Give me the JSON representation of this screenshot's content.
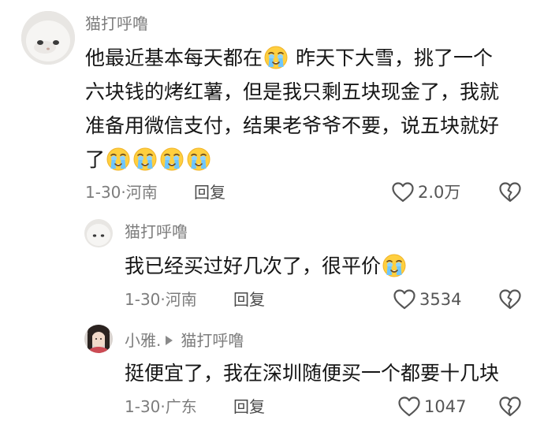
{
  "comments": [
    {
      "username": "猫打呼噜",
      "lines": [
        [
          "他最近基本每天都在",
          " 昨天下大雪，挑了一个"
        ],
        [
          "六块钱的烤红薯，但是我只剩五块现金了，我就"
        ],
        [
          "准备用微信支付，结果老爷爷不要，说五块就好"
        ],
        [
          "了"
        ]
      ],
      "date": "1-30",
      "location": "河南",
      "reply_label": "回复",
      "likes": "2.0万"
    },
    {
      "username": "猫打呼噜",
      "text": "我已经买过好几次了，很平价",
      "date": "1-30",
      "location": "河南",
      "reply_label": "回复",
      "likes": "3534"
    },
    {
      "username": "小雅.",
      "reply_to": "猫打呼噜",
      "text": "挺便宜了，我在深圳随便买一个都要十几块",
      "date": "1-30",
      "location": "广东",
      "reply_label": "回复",
      "likes": "1047"
    }
  ],
  "separator": "·",
  "icons": [
    "teary-smile-emoji-icon",
    "heart-outline-icon",
    "broken-heart-icon",
    "reply-arrow-icon"
  ]
}
